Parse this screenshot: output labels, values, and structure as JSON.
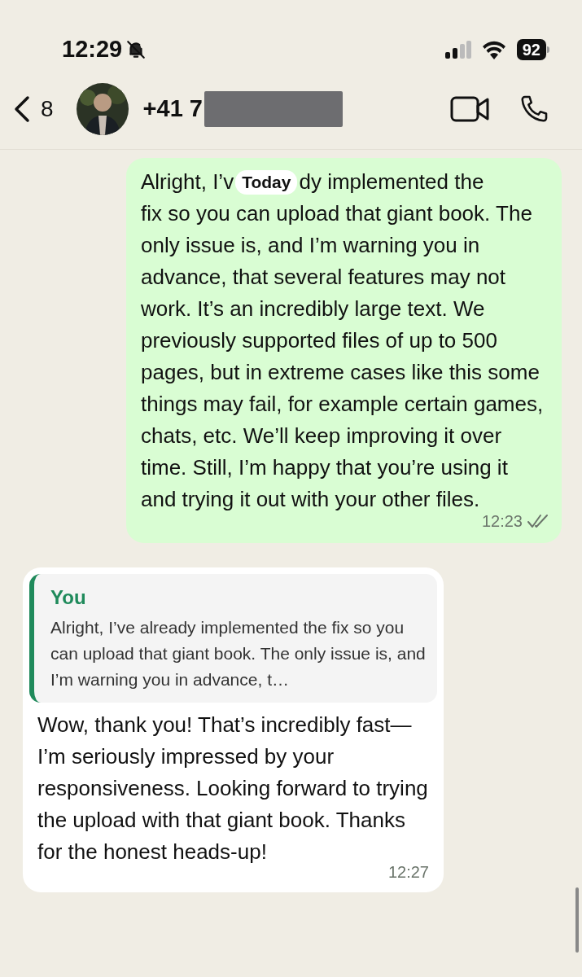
{
  "status_bar": {
    "time": "12:29",
    "silenced": true,
    "battery": "92"
  },
  "header": {
    "back_count": "8",
    "contact": "+41 7",
    "redacted": true
  },
  "date_pill": "Today",
  "messages": [
    {
      "kind": "outgoing",
      "text_before": "Alright, I’v",
      "line_after": "dy implemented the",
      "text_after": "fix so you can upload that giant book. The only issue is, and I’m warning you in advance, that several features may not work. It’s an incredibly large text. We previously supported files of up to 500 pages, but in extreme cases like this some things may fail, for example certain games, chats, etc. We’ll keep improving it over time. Still, I’m happy that you’re using it and trying it out with your other files.",
      "time": "12:23",
      "read": false
    },
    {
      "kind": "incoming",
      "quote": {
        "author": "You",
        "text": "Alright, I’ve already implemented the fix so you can upload that giant book. The only issue is, and I’m warning you in advance, t…"
      },
      "text": "Wow, thank you! That’s incredibly fast—I’m seriously impressed by your responsiveness. Looking forward to trying the upload with that giant book. Thanks for the honest heads-up!",
      "time": "12:27"
    }
  ]
}
